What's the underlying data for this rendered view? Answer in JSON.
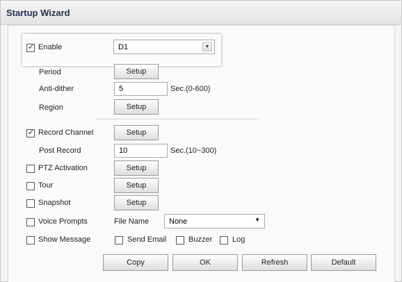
{
  "window": {
    "title": "Startup Wizard"
  },
  "enable": {
    "label": "Enable",
    "checked": true,
    "select_value": "D1"
  },
  "period": {
    "label": "Period",
    "button": "Setup"
  },
  "anti_dither": {
    "label": "Anti-dither",
    "value": "5",
    "hint": "Sec.(0-600)"
  },
  "region": {
    "label": "Region",
    "button": "Setup"
  },
  "record_channel": {
    "label": "Record Channel",
    "checked": true,
    "button": "Setup"
  },
  "post_record": {
    "label": "Post Record",
    "value": "10",
    "hint": "Sec.(10~300)"
  },
  "ptz_activation": {
    "label": "PTZ Activation",
    "checked": false,
    "button": "Setup"
  },
  "tour": {
    "label": "Tour",
    "checked": false,
    "button": "Setup"
  },
  "snapshot": {
    "label": "Snapshot",
    "checked": false,
    "button": "Setup"
  },
  "voice_prompts": {
    "label": "Voice Prompts",
    "checked": false,
    "file_name_label": "File Name",
    "file_value": "None"
  },
  "show_message": {
    "label": "Show Message",
    "checked": false
  },
  "send_email": {
    "label": "Send Email",
    "checked": false
  },
  "buzzer": {
    "label": "Buzzer",
    "checked": false
  },
  "log": {
    "label": "Log",
    "checked": false
  },
  "footer_buttons": {
    "copy": "Copy",
    "ok": "OK",
    "refresh": "Refresh",
    "default": "Default"
  }
}
